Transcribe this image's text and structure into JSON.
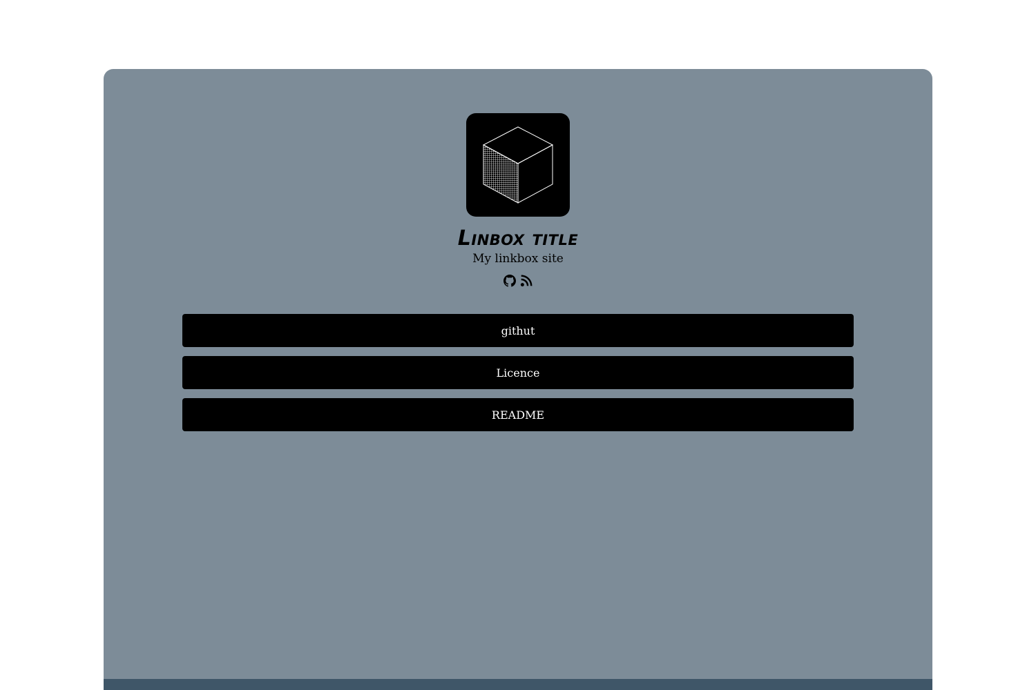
{
  "profile": {
    "title": "Linbox title",
    "subtitle": "My linkbox site",
    "avatar_icon": "wireframe-cube-icon"
  },
  "socials": [
    {
      "icon": "github-icon"
    },
    {
      "icon": "rss-feed-icon"
    }
  ],
  "links": [
    {
      "label": "githut"
    },
    {
      "label": "Licence"
    },
    {
      "label": "README"
    }
  ],
  "colors": {
    "page_background": "#ffffff",
    "card_background": "#7d8c98",
    "button_background": "#000000",
    "button_text": "#ffffff",
    "footer_bar": "#3f5668"
  }
}
